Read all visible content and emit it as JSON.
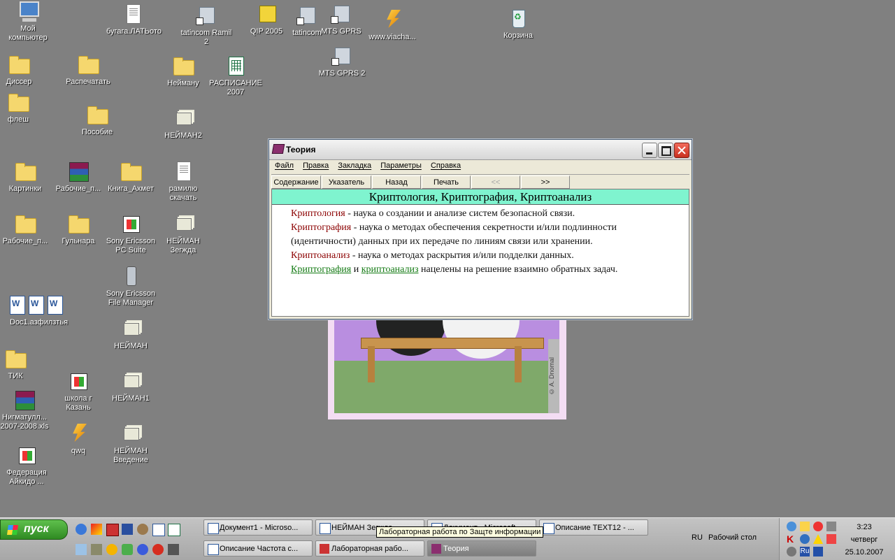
{
  "desktop": {
    "icons": [
      {
        "label": "Мой компьютер",
        "icon": "computer-icon"
      },
      {
        "label": "бугага.ЛАТЬото",
        "icon": "documents-icon"
      },
      {
        "label": "tatincom Ramil 2",
        "icon": "network-shortcut-icon"
      },
      {
        "label": "QIP 2005",
        "icon": "qip-icon"
      },
      {
        "label": "tatincom",
        "icon": "network-shortcut-icon"
      },
      {
        "label": "MTS GPRS",
        "icon": "network-shortcut-icon"
      },
      {
        "label": "www.viacha...",
        "icon": "winamp-icon"
      },
      {
        "label": "Корзина",
        "icon": "recycle-bin-icon"
      },
      {
        "label": "MTS GPRS 2",
        "icon": "network-shortcut-icon"
      },
      {
        "label": "Диссер",
        "icon": "folder-icon"
      },
      {
        "label": "Распечатать",
        "icon": "folder-icon"
      },
      {
        "label": "Нейману",
        "icon": "folder-icon"
      },
      {
        "label": "РАСПИСАНИЕ 2007",
        "icon": "excel-file-icon"
      },
      {
        "label": "флеш",
        "icon": "folder-icon"
      },
      {
        "label": "Пособие",
        "icon": "folder-icon"
      },
      {
        "label": "НЕЙМАН2",
        "icon": "document-stack-icon"
      },
      {
        "label": "Картинки",
        "icon": "folder-icon"
      },
      {
        "label": "Рабочие_п...",
        "icon": "winrar-icon"
      },
      {
        "label": "Книга_Ахмет",
        "icon": "folder-icon"
      },
      {
        "label": "рамилю скачать",
        "icon": "text-file-icon"
      },
      {
        "label": "Рабочие_п...",
        "icon": "folder-icon"
      },
      {
        "label": "Гульнара",
        "icon": "folder-icon"
      },
      {
        "label": "Sony Ericsson PC Suite",
        "icon": "sony-ericsson-icon"
      },
      {
        "label": "НЕЙМАН Зегжда",
        "icon": "document-stack-icon"
      },
      {
        "label": "Sony Ericsson File Manager",
        "icon": "phone-icon"
      },
      {
        "label": "Doc1.азфилзтья",
        "icon": "word-docs-icon"
      },
      {
        "label": "НЕЙМАН",
        "icon": "document-stack-icon"
      },
      {
        "label": "ТИК",
        "icon": "folder-icon"
      },
      {
        "label": "школа г Казань",
        "icon": "program-icon"
      },
      {
        "label": "НЕЙМАН1",
        "icon": "document-stack-icon"
      },
      {
        "label": "Нигматулл... 2007-2008.xls",
        "icon": "winrar-icon"
      },
      {
        "label": "qwq",
        "icon": "winamp-icon"
      },
      {
        "label": "НЕЙМАН Введение",
        "icon": "document-stack-icon"
      },
      {
        "label": "Федерация Айкидо ...",
        "icon": "program-icon"
      }
    ]
  },
  "picture": {
    "signature": "© A. Dnomal"
  },
  "window": {
    "title": "Теория",
    "menu": [
      "Файл",
      "Правка",
      "Закладка",
      "Параметры",
      "Справка"
    ],
    "toolbar": [
      "Содержание",
      "Указатель",
      "Назад",
      "Печать",
      "<<",
      ">>"
    ],
    "topic_title": "Криптология, Криптография, Криптоанализ",
    "lines": {
      "l1_term": "Криптология",
      "l1_rest": " - наука о создании и анализе систем безопасной связи.",
      "l2_term": "Криптография",
      "l2_rest": " - наука о методах обеспечения секретности и/или подлинности",
      "l3": "(идентичности) данных при их передаче по линиям связи или хранении.",
      "l4_term": "Криптоанализ",
      "l4_rest": " - наука о методах раскрытия и/или подделки данных.",
      "l5_link1": "Криптография",
      "l5_and": " и ",
      "l5_link2": "криптоанализ",
      "l5_rest": " нацелены на решение взаимно обратных задач."
    }
  },
  "taskbar": {
    "start_label": "пуск",
    "tasks_row1": [
      "Документ1 - Microso...",
      "НЕЙМАН Зегжда - ...",
      "Документ - Microsoft...",
      "Описание TEXT12 - ..."
    ],
    "tasks_row2": [
      "Описание Частота с...",
      "Лабораторная рабо...",
      "Теория"
    ],
    "tooltip": "Лабораторная работа по Защте информации",
    "lang": "RU",
    "deskbar": "Рабочий стол",
    "clock_time": "3:23",
    "clock_day": "четверг",
    "clock_date": "25.10.2007"
  }
}
